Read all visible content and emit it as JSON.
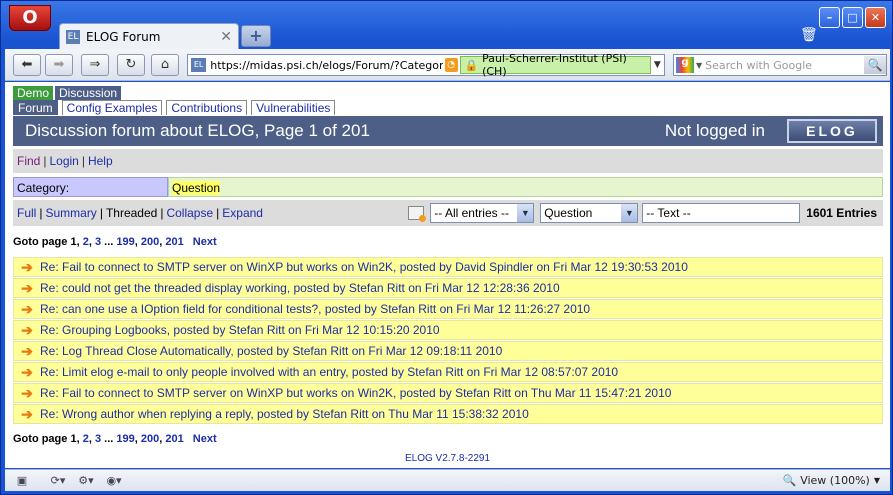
{
  "browser": {
    "tab_title": "ELOG Forum",
    "url": "https://midas.psi.ch/elogs/Forum/?Category=%5",
    "security_label": "Paul-Scherrer-Institut (PSI) (CH)",
    "search_placeholder": "Search with Google",
    "zoom": "View (100%)"
  },
  "logbook_groups": [
    {
      "label": "Demo"
    },
    {
      "label": "Discussion"
    }
  ],
  "logbook_tabs": [
    {
      "label": "Forum"
    },
    {
      "label": "Config Examples"
    },
    {
      "label": "Contributions"
    },
    {
      "label": "Vulnerabilities"
    }
  ],
  "header": {
    "title": "Discussion forum about ELOG, Page 1 of 201",
    "login_status": "Not logged in",
    "logo": "ELOG"
  },
  "menu": {
    "find": "Find",
    "login": "Login",
    "help": "Help"
  },
  "category": {
    "label": "Category:",
    "value": "Question"
  },
  "views": {
    "full": "Full",
    "summary": "Summary",
    "threaded": "Threaded",
    "collapse": "Collapse",
    "expand": "Expand"
  },
  "filters": {
    "entries_select": "-- All entries --",
    "category_select": "Question",
    "text_field": "-- Text --",
    "entry_count": "1601 Entries"
  },
  "pagination": {
    "label": "Goto page",
    "current": "1",
    "p2": "2",
    "p3": "3",
    "ellipsis": "...",
    "p199": "199",
    "p200": "200",
    "p201": "201",
    "next": "Next"
  },
  "entries": [
    "Re: Fail to connect to SMTP server on WinXP but works on Win2K, posted by David Spindler on Fri Mar 12 19:30:53 2010",
    "Re: could not get the threaded display working, posted by Stefan Ritt on Fri Mar 12 12:28:36 2010",
    "Re: can one use a IOption field for conditional tests?, posted by Stefan Ritt on Fri Mar 12 11:26:27 2010",
    "Re: Grouping Logbooks, posted by Stefan Ritt on Fri Mar 12 10:15:20 2010",
    "Re: Log Thread Close Automatically, posted by Stefan Ritt on Fri Mar 12 09:18:11 2010",
    "Re: Limit elog e-mail to only people involved with an entry, posted by Stefan Ritt on Fri Mar 12 08:57:07 2010",
    "Re: Fail to connect to SMTP server on WinXP but works on Win2K, posted by Stefan Ritt on Thu Mar 11 15:47:21 2010",
    "Re: Wrong author when replying a reply, posted by Stefan Ritt on Thu Mar 11 15:38:32 2010"
  ],
  "footer": "ELOG V2.7.8-2291"
}
